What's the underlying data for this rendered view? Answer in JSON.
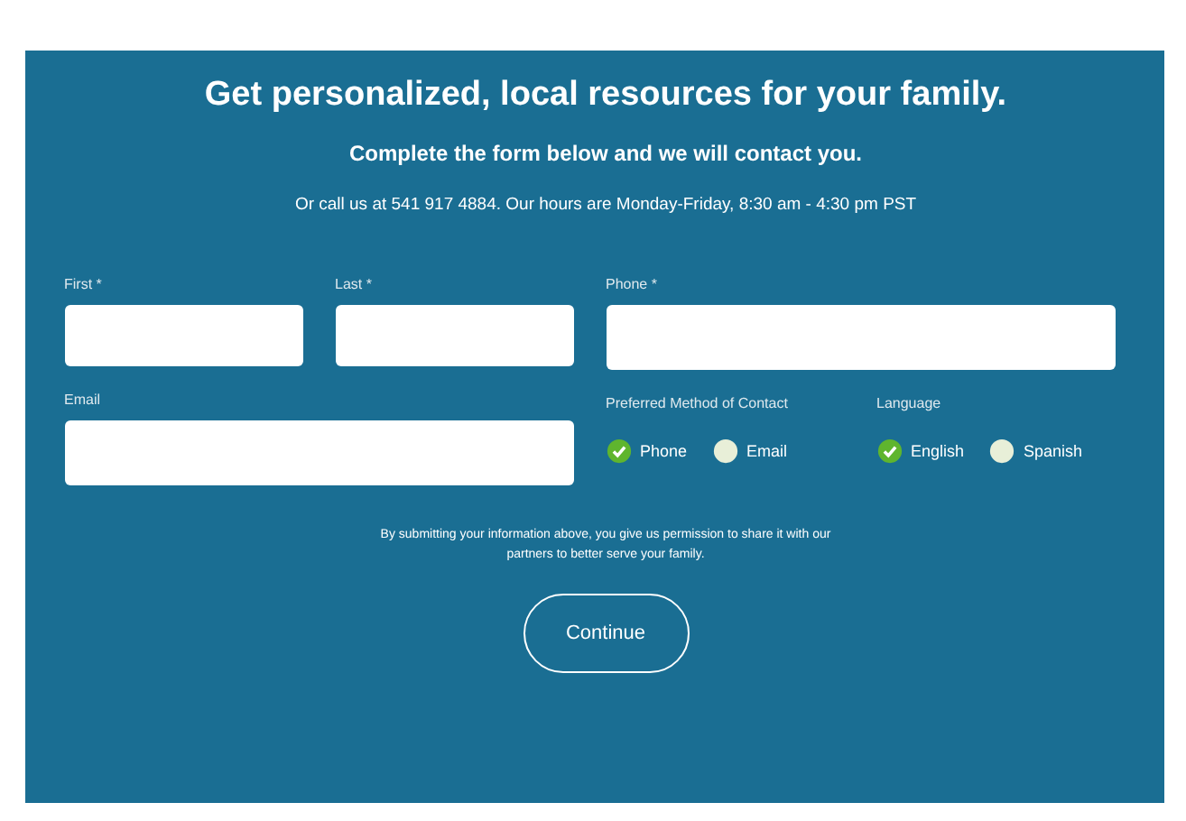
{
  "heading": "Get personalized, local resources for your family.",
  "subheading": "Complete the form below and we will contact you.",
  "contact_line": "Or call us at 541 917 4884. Our hours are Monday-Friday, 8:30 am - 4:30 pm PST",
  "fields": [
    {
      "label": "First *"
    },
    {
      "label": "Last *"
    },
    {
      "label": "Phone *"
    },
    {
      "label": "Email"
    }
  ],
  "radio_groups": [
    {
      "label": "Preferred Method of Contact",
      "options": [
        {
          "label": "Phone",
          "selected": true
        },
        {
          "label": "Email",
          "selected": false
        }
      ]
    },
    {
      "label": "Language",
      "options": [
        {
          "label": "English",
          "selected": true
        },
        {
          "label": "Spanish",
          "selected": false
        }
      ]
    }
  ],
  "disclaimer": "By submitting your information above, you give us permission to share it with our partners to better serve your family.",
  "button": "Continue"
}
